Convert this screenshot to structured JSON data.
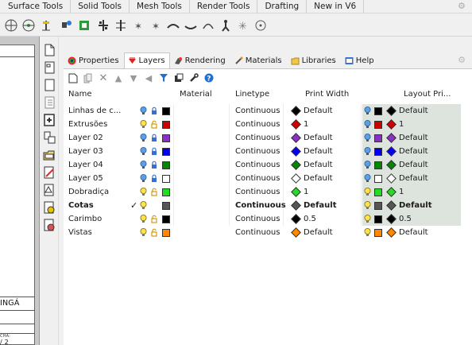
{
  "top_tabs": [
    "Surface Tools",
    "Solid Tools",
    "Mesh Tools",
    "Render Tools",
    "Drafting",
    "New in V6"
  ],
  "panel_tabs": [
    {
      "label": "Properties",
      "icon": "properties-icon",
      "active": false
    },
    {
      "label": "Layers",
      "icon": "layers-icon",
      "active": true
    },
    {
      "label": "Rendering",
      "icon": "rendering-icon",
      "active": false
    },
    {
      "label": "Materials",
      "icon": "materials-icon",
      "active": false
    },
    {
      "label": "Libraries",
      "icon": "libraries-icon",
      "active": false
    },
    {
      "label": "Help",
      "icon": "help-icon",
      "active": false
    }
  ],
  "columns": {
    "name": "Name",
    "material": "Material",
    "linetype": "Linetype",
    "print_width": "Print Width",
    "layout_print": "Layout Pri..."
  },
  "layers": [
    {
      "name": "Linhas de c...",
      "on": true,
      "locked": false,
      "color": "#000000",
      "linetype": "Continuous",
      "print_color": "#000000",
      "print_width": "Default",
      "current": false,
      "bold": false
    },
    {
      "name": "Extrusões",
      "on": true,
      "locked": false,
      "color": "#cc0000",
      "linetype": "Continuous",
      "print_color": "#cc0000",
      "print_width": "1",
      "current": false,
      "bold": false
    },
    {
      "name": "Layer 02",
      "on": true,
      "locked": false,
      "color": "#8b2fc9",
      "linetype": "Continuous",
      "print_color": "#8b2fc9",
      "print_width": "Default",
      "current": false,
      "bold": false
    },
    {
      "name": "Layer 03",
      "on": true,
      "locked": false,
      "color": "#0000ee",
      "linetype": "Continuous",
      "print_color": "#0000ee",
      "print_width": "Default",
      "current": false,
      "bold": false
    },
    {
      "name": "Layer 04",
      "on": true,
      "locked": false,
      "color": "#008800",
      "linetype": "Continuous",
      "print_color": "#008800",
      "print_width": "Default",
      "current": false,
      "bold": false
    },
    {
      "name": "Layer 05",
      "on": true,
      "locked": false,
      "color": "#ffffff",
      "linetype": "Continuous",
      "print_color": "#ffffff",
      "print_width": "Default",
      "current": false,
      "bold": false
    },
    {
      "name": "Dobradiça",
      "on": true,
      "locked": false,
      "color": "#22dd22",
      "linetype": "Continuous",
      "print_color": "#22dd22",
      "print_width": "1",
      "current": false,
      "bold": false
    },
    {
      "name": "Cotas",
      "on": true,
      "locked": false,
      "color": "#555555",
      "linetype": "Continuous",
      "print_color": "#555555",
      "print_width": "Default",
      "current": true,
      "bold": true
    },
    {
      "name": "Carimbo",
      "on": true,
      "locked": false,
      "color": "#000000",
      "linetype": "Continuous",
      "print_color": "#000000",
      "print_width": "0.5",
      "current": false,
      "bold": false
    },
    {
      "name": "Vistas",
      "on": true,
      "locked": false,
      "color": "#ff8800",
      "linetype": "Continuous",
      "print_color": "#ff8800",
      "print_width": "Default",
      "current": false,
      "bold": false
    }
  ],
  "current_marker": "✓",
  "viewport_texts": [
    "INGÁ",
    "CHA:",
    "/ 2"
  ]
}
